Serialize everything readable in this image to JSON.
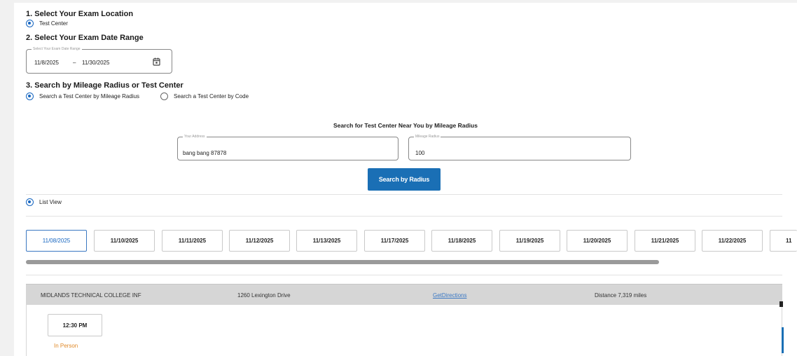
{
  "section1": {
    "title": "1. Select Your Exam Location",
    "option": "Test Center"
  },
  "section2": {
    "title": "2. Select Your Exam Date Range",
    "field_label": "Select Your Exam Date Range",
    "start": "11/8/2025",
    "separator": "–",
    "end": "11/30/2025",
    "icon": "calendar-icon"
  },
  "section3": {
    "title": "3. Search by Mileage Radius or Test Center",
    "option_radius": "Search a Test Center by Mileage Radius",
    "option_code": "Search a Test Center by Code"
  },
  "search": {
    "heading": "Search for Test Center Near You by Mileage Radius",
    "address_label": "Your Address",
    "address_value": "bang bang 87878",
    "radius_label": "Mileage Radius",
    "radius_value": "100",
    "button": "Search by Radius"
  },
  "view": {
    "list_view": "List View"
  },
  "dates": [
    "11/08/2025",
    "11/10/2025",
    "11/11/2025",
    "11/12/2025",
    "11/13/2025",
    "11/17/2025",
    "11/18/2025",
    "11/19/2025",
    "11/20/2025",
    "11/21/2025",
    "11/22/2025",
    "11"
  ],
  "result": {
    "name": "MIDLANDS TECHNICAL COLLEGE INF",
    "address": "1260 Lexington Drive",
    "directions": "GetDirections",
    "distance": "Distance 7,319 miles",
    "time": "12:30 PM",
    "mode": "In Person"
  },
  "colors": {
    "accent": "#1a6fb5",
    "in_person": "#e08a2a",
    "header_bg": "#d6d6d6"
  }
}
